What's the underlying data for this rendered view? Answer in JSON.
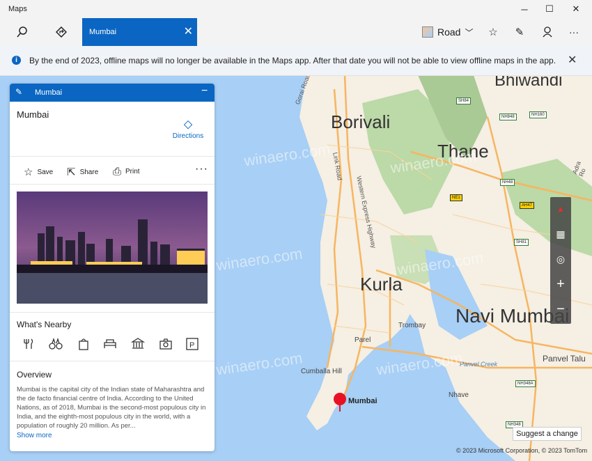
{
  "app": {
    "title": "Maps"
  },
  "window_controls": {
    "minimize": "─",
    "maximize": "☐",
    "close": "✕"
  },
  "toolbar": {
    "active_tab": "Mumbai",
    "map_style": "Road"
  },
  "banner": {
    "message": "By the end of 2023, offline maps will no longer be available in the Maps app. After that date you will not be able to view offline maps in the app."
  },
  "panel": {
    "header": "Mumbai",
    "place_name": "Mumbai",
    "directions_label": "Directions",
    "actions": {
      "save": "Save",
      "share": "Share",
      "print": "Print"
    },
    "nearby_title": "What's Nearby",
    "nearby_icons": [
      "restaurant-icon",
      "binoculars-icon",
      "shopping-bag-icon",
      "hotel-icon",
      "museum-icon",
      "camera-icon",
      "parking-icon"
    ],
    "overview_title": "Overview",
    "overview_text": "Mumbai is the capital city of the Indian state of Maharashtra and the de facto financial centre of India. According to the United Nations, as of 2018, Mumbai is the second-most populous city in India, and the eighth-most populous city in the world, with a population of roughly 20 million. As per...",
    "show_more": "Show more"
  },
  "map": {
    "labels": {
      "bhiwandi": "Bhiwandi",
      "borivali": "Borivali",
      "thane": "Thane",
      "kurla": "Kurla",
      "navi_mumbai": "Navi Mumbai",
      "mumbai": "Mumbai",
      "trombay": "Trombay",
      "parel": "Parel",
      "cumballa_hill": "Cumballa Hill",
      "nhave": "Nhave",
      "panvel_taluka": "Panvel Talu",
      "panvel_creek": "Panvel Creek",
      "gorai_road": "Gorai Road",
      "link_road": "Link Road",
      "western_express": "Western Express Highway",
      "adra": "Adra Ro",
      "sh84": "SH84",
      "nh848": "NH848",
      "nh160": "NH160",
      "nh48": "NH48",
      "sh81": "SH81",
      "ah47": "AH47",
      "ne1": "NE1",
      "nh348a": "NH348A",
      "nh348": "NH348"
    },
    "suggest_change": "Suggest a change",
    "copyright": "© 2023 Microsoft Corporation, © 2023 TomTom",
    "watermark": "winaero.com"
  },
  "colors": {
    "accent": "#0a66c2",
    "water": "#a8cff5",
    "land": "#f5efe4",
    "park": "#bcd9a8",
    "road": "#f7b55f"
  }
}
